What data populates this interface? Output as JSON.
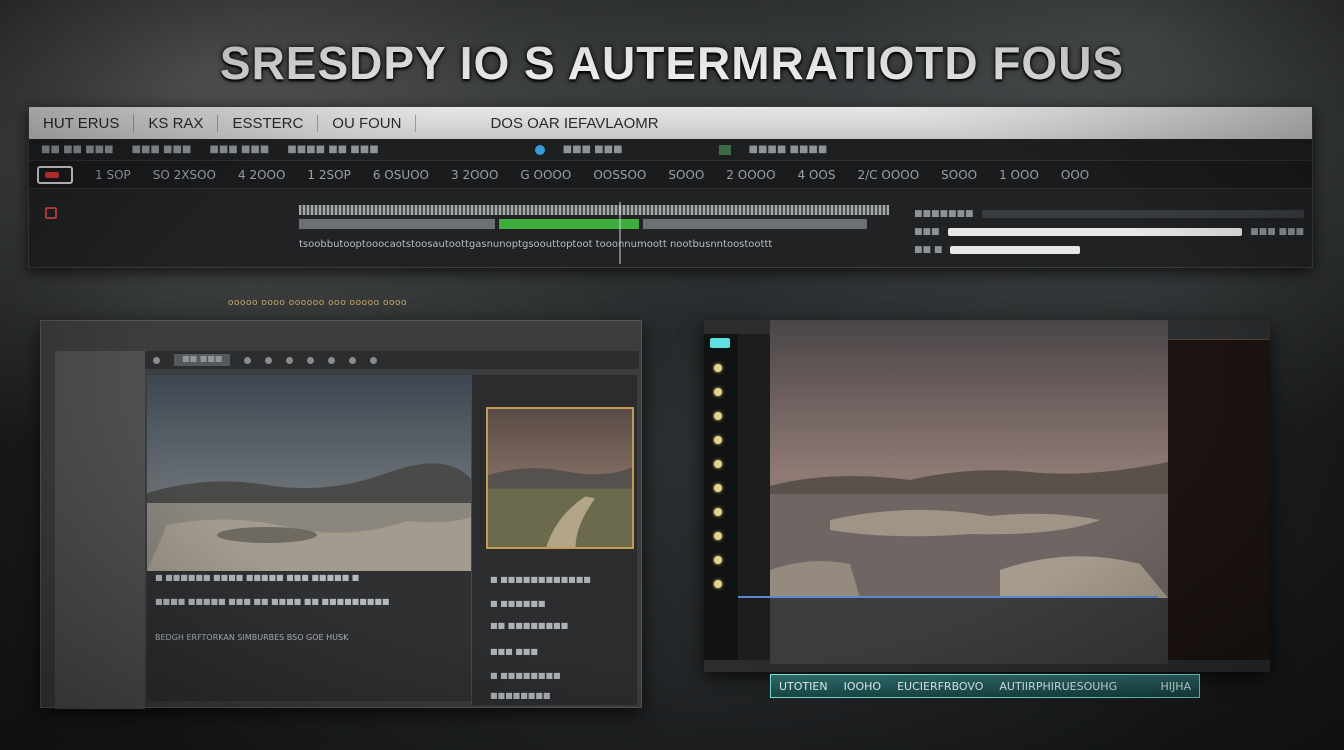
{
  "headline": "SRESDPY IO S AUTERMRATIOTD FOUS",
  "top_panel": {
    "menu": [
      "HUT ERUS",
      "KS RAX",
      "ESSTERC",
      "OU FOUN"
    ],
    "menu_right": "DOS OAR IEFAVLAOMR",
    "toolbar": [
      "■■ ■■ ■■■",
      "■■■ ■■■",
      "■■■ ■■■",
      "■■■■ ■■ ■■■"
    ],
    "toolbar_mid": [
      "■■■ ■■■",
      "■■■■ ■■■■"
    ],
    "track_labels": [
      "1 SOP",
      "SO 2XSOO",
      "4 2OOO",
      "1 2SOP",
      "6 OSUOO",
      "3 2OOO",
      "G OOOO",
      "OOSSOO",
      "SOOO",
      "2 OOOO",
      "4 OOS",
      "2/C OOOO",
      "SOOO",
      "1 OOO",
      "OOO"
    ],
    "caption": "tsoobbutooptooocaotstoosautoottgasnunoptgsoouttoptoot tooonnumoott nootbusnntoostoottt"
  },
  "sub_caption": "ooooo oooo oooooo ooo ooooo oooo",
  "left_window": {
    "tab": "■■ ■■■",
    "main_lines": [
      "■ ■■■■■■ ■■■■ ■■■■■ ■■■ ■■■■■ ■",
      "■■■■ ■■■■■ ■■■ ■■ ■■■■ ■■ ■■■■■■■■■",
      "BEDGH ERFTORKAN SIMBURBES BSO GOE HUSK"
    ],
    "side_lines": [
      "■ ■■■■■■■■■■■■",
      "■ ■■■■■■",
      "■■ ■■■■■■■■",
      "■■■ ■■■",
      "■ ■■■■■■■■",
      "■■■■■■■■"
    ]
  },
  "right_window": {
    "status": [
      "UTOTIEN",
      "IOOHO",
      "EUCIERFRBOVO",
      "AUTIIRPHIRUESOUHG",
      "HIJHA"
    ]
  },
  "colors": {
    "accent_teal": "#5fe0e0",
    "accent_green": "#3fae3f",
    "accent_gold": "#c49a55"
  }
}
